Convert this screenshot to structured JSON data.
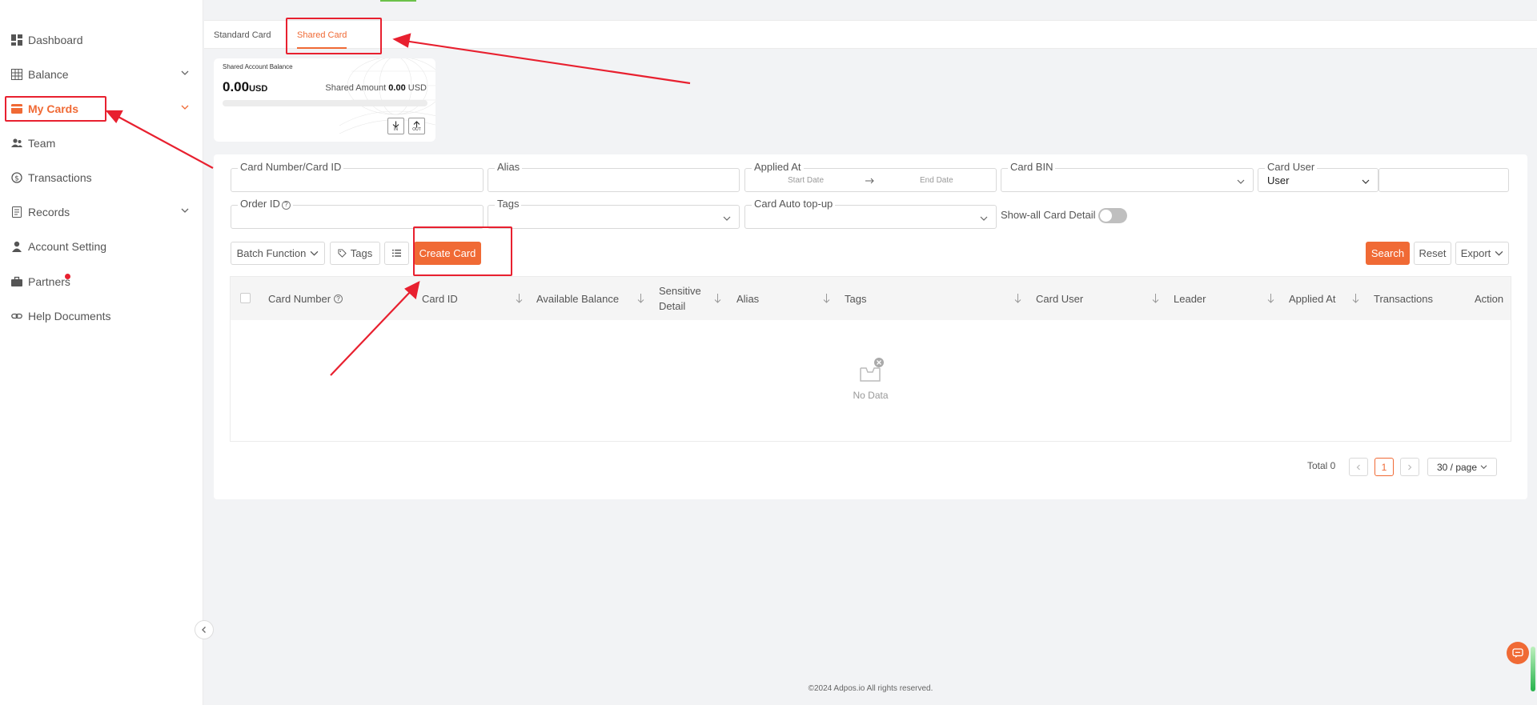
{
  "sidebar": {
    "items": [
      {
        "label": "Dashboard",
        "icon": "dashboard-icon"
      },
      {
        "label": "Balance",
        "icon": "table-icon"
      },
      {
        "label": "My Cards",
        "icon": "card-icon"
      },
      {
        "label": "Team",
        "icon": "team-icon"
      },
      {
        "label": "Transactions",
        "icon": "dollar-cycle-icon"
      },
      {
        "label": "Records",
        "icon": "document-icon"
      },
      {
        "label": "Account Setting",
        "icon": "user-icon"
      },
      {
        "label": "Partners",
        "icon": "briefcase-icon"
      },
      {
        "label": "Help Documents",
        "icon": "link-icon"
      }
    ]
  },
  "tabs": {
    "standard": "Standard Card",
    "shared": "Shared Card"
  },
  "balance": {
    "title": "Shared Account Balance",
    "amount": "0.00",
    "currency": "USD",
    "shared_label": "Shared Amount",
    "shared_value": "0.00",
    "shared_currency": "USD",
    "in_label": "IN",
    "out_label": "OUT"
  },
  "filters": {
    "card_number": "Card Number/Card ID",
    "alias": "Alias",
    "applied_at": "Applied At",
    "start_date": "Start Date",
    "end_date": "End Date",
    "card_bin": "Card BIN",
    "card_user": "Card User",
    "card_user_value": "User",
    "order_id": "Order ID",
    "tags": "Tags",
    "auto_topup": "Card Auto top-up",
    "show_all": "Show-all Card Detail"
  },
  "toolbar": {
    "batch": "Batch Function",
    "tags": "Tags",
    "create": "Create Card",
    "search": "Search",
    "reset": "Reset",
    "export": "Export"
  },
  "table": {
    "columns": [
      "Card Number",
      "Card ID",
      "Available Balance",
      "Sensitive",
      "Detail",
      "Alias",
      "Tags",
      "Card User",
      "Leader",
      "Applied At",
      "Transactions",
      "Action"
    ],
    "empty": "No Data"
  },
  "pagination": {
    "total": "Total 0",
    "current": "1",
    "page_size": "30 / page"
  },
  "footer": "©2024 Adpos.io All rights reserved.",
  "colors": {
    "accent": "#f06a35",
    "annotation": "#e8202f"
  }
}
